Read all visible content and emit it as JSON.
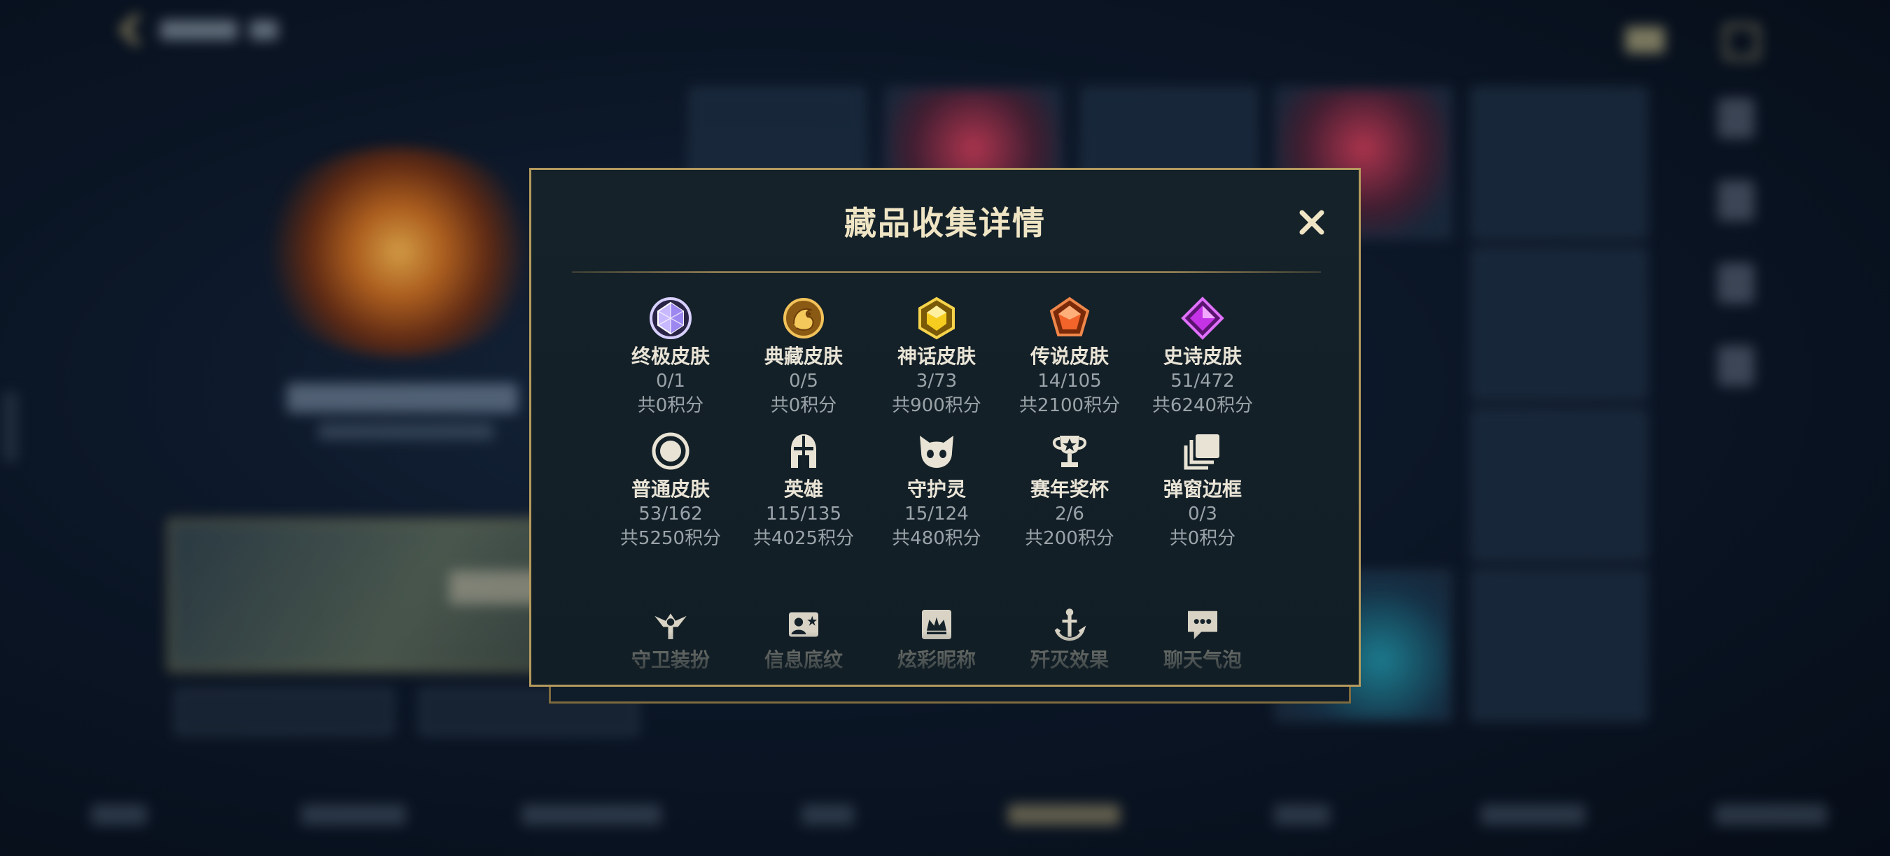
{
  "dialog": {
    "title": "藏品收集详情",
    "close_label": "✕"
  },
  "collections": [
    {
      "label": "终极皮肤",
      "count": "0/1",
      "points": "共0积分",
      "icon": "ultimate-skin-gem-icon",
      "color": "#b9a6ff"
    },
    {
      "label": "典藏皮肤",
      "count": "0/5",
      "points": "共0积分",
      "icon": "treasure-skin-dragon-icon",
      "color": "#e0a93c"
    },
    {
      "label": "神话皮肤",
      "count": "3/73",
      "points": "共900积分",
      "icon": "mythic-skin-gem-icon",
      "color": "#f0c419"
    },
    {
      "label": "传说皮肤",
      "count": "14/105",
      "points": "共2100积分",
      "icon": "legendary-skin-gem-icon",
      "color": "#f06a28"
    },
    {
      "label": "史诗皮肤",
      "count": "51/472",
      "points": "共6240积分",
      "icon": "epic-skin-gem-icon",
      "color": "#c23be0"
    },
    {
      "label": "普通皮肤",
      "count": "53/162",
      "points": "共5250积分",
      "icon": "common-skin-ring-icon",
      "color": "#e8e3d4"
    },
    {
      "label": "英雄",
      "count": "115/135",
      "points": "共4025积分",
      "icon": "hero-helmet-icon",
      "color": "#e8e3d4"
    },
    {
      "label": "守护灵",
      "count": "15/124",
      "points": "共480积分",
      "icon": "guardian-spirit-cat-icon",
      "color": "#e8e3d4"
    },
    {
      "label": "赛年奖杯",
      "count": "2/6",
      "points": "共200积分",
      "icon": "trophy-icon",
      "color": "#e8e3d4"
    },
    {
      "label": "弹窗边框",
      "count": "0/3",
      "points": "共0积分",
      "icon": "popup-frame-icon",
      "color": "#e8e3d4"
    }
  ],
  "collections_more": [
    {
      "label": "守卫装扮",
      "icon": "ward-skin-icon"
    },
    {
      "label": "信息底纹",
      "icon": "profile-banner-icon"
    },
    {
      "label": "炫彩昵称",
      "icon": "colorful-nickname-icon"
    },
    {
      "label": "歼灭效果",
      "icon": "elimination-effect-icon"
    },
    {
      "label": "聊天气泡",
      "icon": "chat-bubble-icon"
    }
  ]
}
